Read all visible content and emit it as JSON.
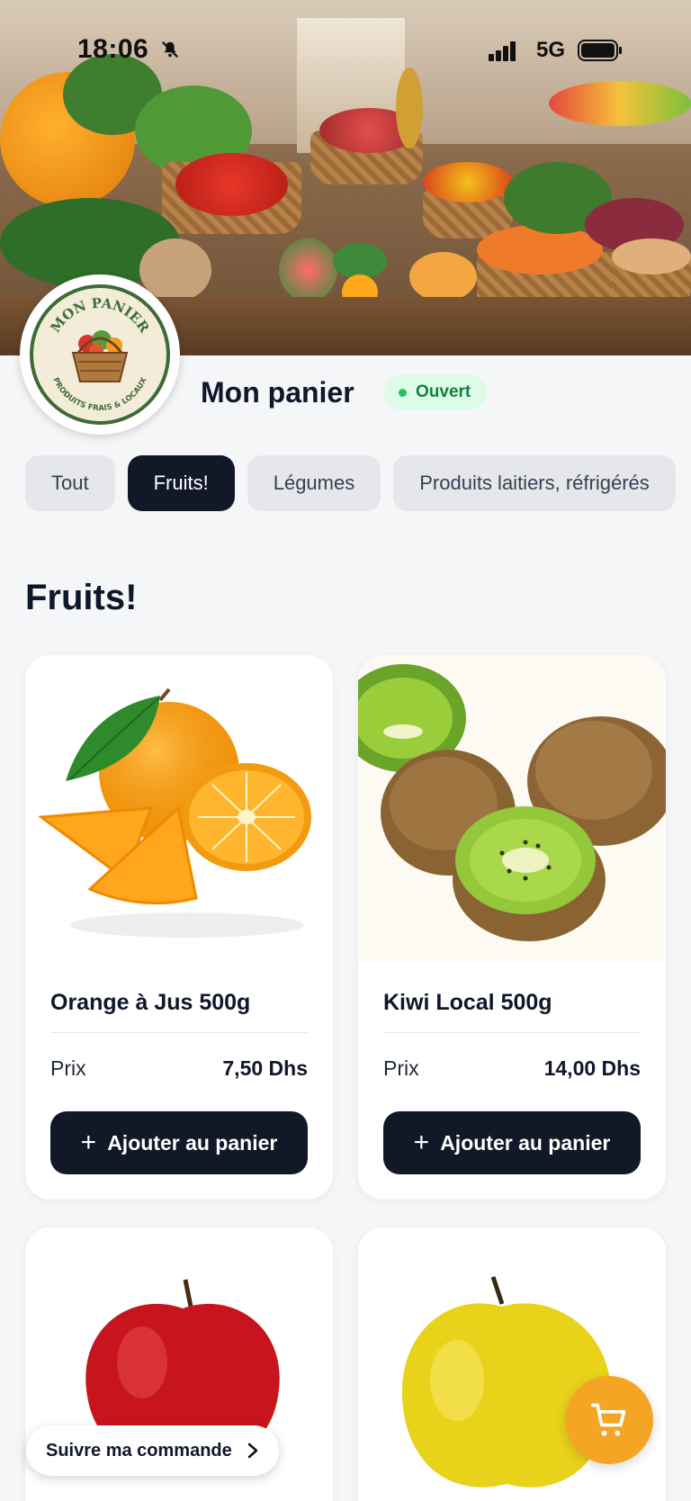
{
  "status_bar": {
    "time": "18:06",
    "network": "5G"
  },
  "store": {
    "logo_text_top": "MON PANIER",
    "logo_text_bottom": "PRODUITS FRAIS & LOCAUX",
    "name": "Mon panier",
    "status": "Ouvert"
  },
  "categories": {
    "tabs": [
      {
        "label": "Tout",
        "active": false
      },
      {
        "label": "Fruits!",
        "active": true
      },
      {
        "label": "Légumes",
        "active": false
      },
      {
        "label": "Produits laitiers, réfrigérés",
        "active": false
      }
    ]
  },
  "section": {
    "title": "Fruits!"
  },
  "products": [
    {
      "name": "Orange à Jus 500g",
      "price_label": "Prix",
      "price": "7,50 Dhs",
      "button": "Ajouter au panier",
      "image": "orange"
    },
    {
      "name": "Kiwi Local 500g",
      "price_label": "Prix",
      "price": "14,00 Dhs",
      "button": "Ajouter au panier",
      "image": "kiwi"
    },
    {
      "name": "",
      "image": "red-apple"
    },
    {
      "name": "",
      "image": "yellow-apple"
    }
  ],
  "track_order": {
    "label": "Suivre ma commande"
  },
  "colors": {
    "accent_dark": "#111827",
    "open_green": "#22c55e",
    "cart_orange": "#f5a524",
    "background": "#f5f6f8"
  },
  "icons": [
    "bell-off-icon",
    "signal-icon",
    "battery-icon",
    "plus-icon",
    "chevron-right-icon",
    "cart-icon"
  ]
}
